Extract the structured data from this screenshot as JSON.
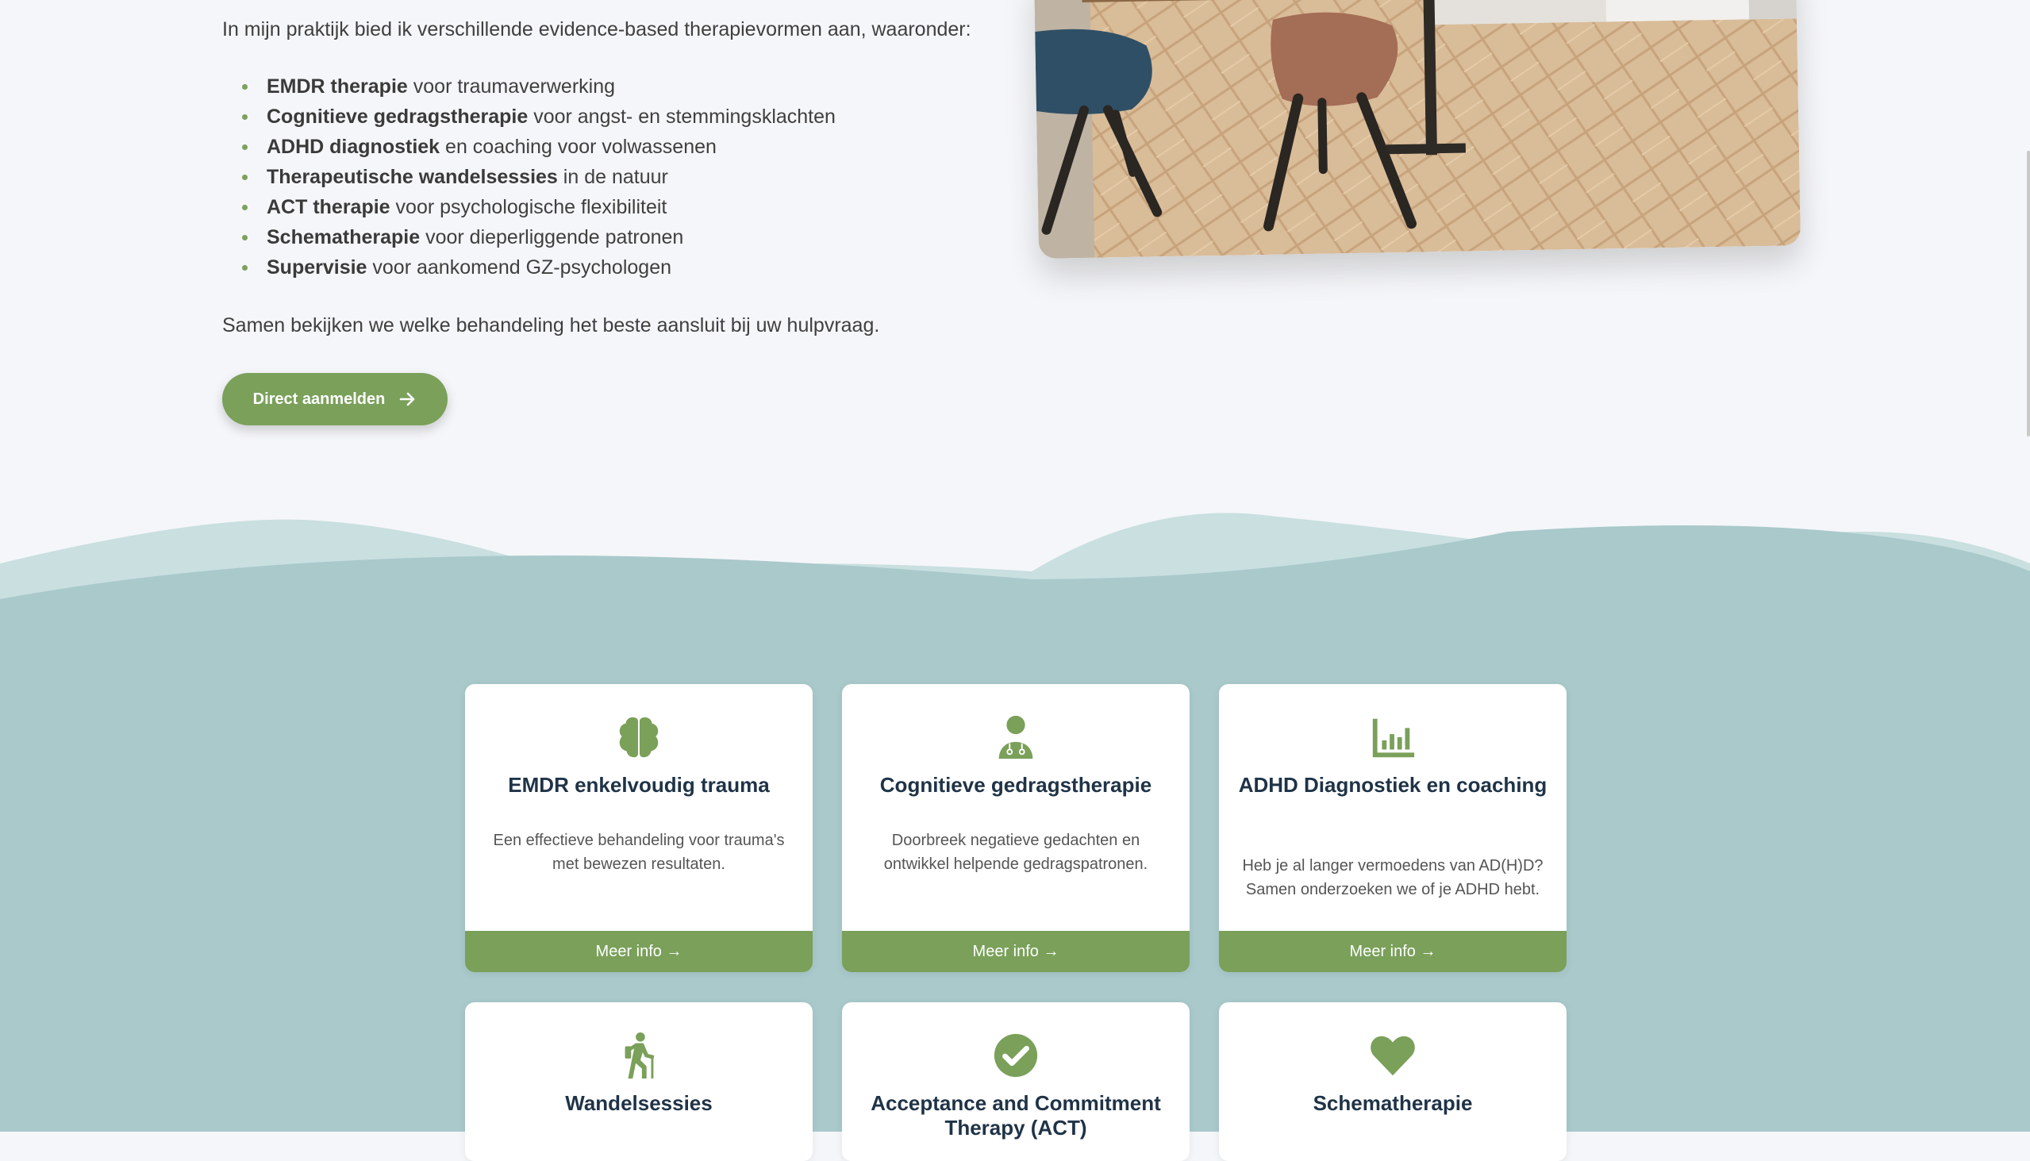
{
  "intro": {
    "text": "In mijn praktijk bied ik verschillende evidence-based therapievormen aan, waaronder:"
  },
  "therapies": [
    {
      "bold": "EMDR therapie",
      "rest": " voor traumaverwerking"
    },
    {
      "bold": "Cognitieve gedragstherapie",
      "rest": " voor angst- en stemmingsklachten"
    },
    {
      "bold": "ADHD diagnostiek",
      "rest": " en coaching voor volwassenen"
    },
    {
      "bold": "Therapeutische wandelsessies",
      "rest": " in de natuur"
    },
    {
      "bold": "ACT therapie",
      "rest": " voor psychologische flexibiliteit"
    },
    {
      "bold": "Schematherapie",
      "rest": " voor dieperliggende patronen"
    },
    {
      "bold": "Supervisie",
      "rest": " voor aankomend GZ-psychologen"
    }
  ],
  "outro": "Samen bekijken we welke behandeling het beste aansluit bij uw hulpvraag.",
  "cta": {
    "label": "Direct aanmelden"
  },
  "cards": [
    {
      "icon": "brain-icon",
      "title": "EMDR enkelvoudig trauma",
      "desc": "Een effectieve behandeling voor trauma's met bewezen resultaten.",
      "link": "Meer info →"
    },
    {
      "icon": "doctor-icon",
      "title": "Cognitieve gedragstherapie",
      "desc": "Doorbreek negatieve gedachten en ontwikkel helpende gedragspatronen.",
      "link": "Meer info →"
    },
    {
      "icon": "bar-chart-icon",
      "title": "ADHD Diagnostiek en coaching",
      "desc": "Heb je al langer vermoedens van AD(H)D? Samen onderzoeken we of je ADHD hebt.",
      "link": "Meer info →"
    },
    {
      "icon": "hiking-icon",
      "title": "Wandelsessies"
    },
    {
      "icon": "check-circle-icon",
      "title": "Acceptance and Commitment Therapy (ACT)"
    },
    {
      "icon": "heart-icon",
      "title": "Schematherapie"
    }
  ],
  "colors": {
    "accent_green": "#7aa05a",
    "teal_background": "#a9c9cb",
    "heading_navy": "#1f3347",
    "page_background": "#f5f6f9"
  }
}
